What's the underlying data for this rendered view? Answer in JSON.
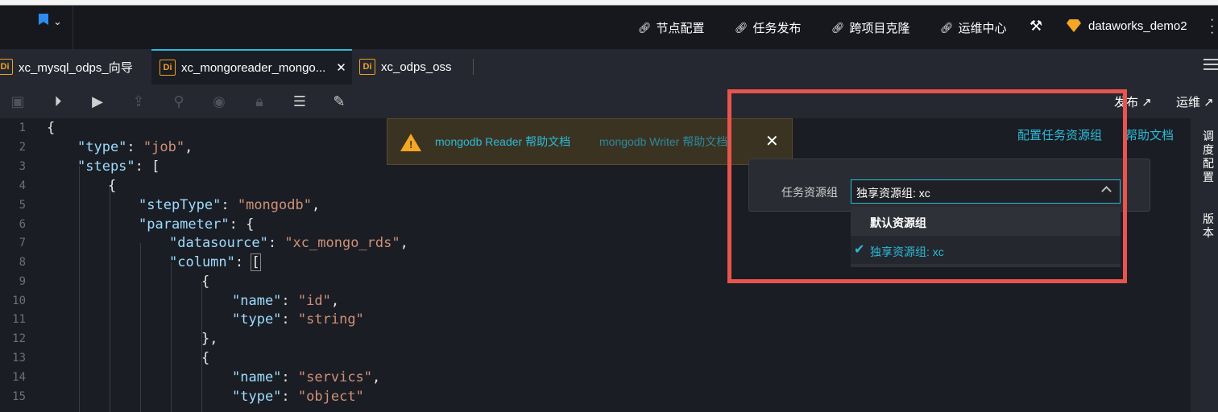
{
  "header": {
    "nav": [
      "节点配置",
      "任务发布",
      "跨项目克隆",
      "运维中心"
    ],
    "user": "dataworks_demo2"
  },
  "tabs": [
    {
      "label": "xc_mysql_odps_向导",
      "icon": "Di"
    },
    {
      "label": "xc_mongoreader_mongo...",
      "icon": "Di",
      "active": true
    },
    {
      "label": "xc_odps_oss",
      "icon": "Di"
    }
  ],
  "toolbar": {
    "publish_label": "发布 ↗",
    "ops_label": "运维 ↗"
  },
  "rail": {
    "schedule_label": "调度配置",
    "version_label": "版本"
  },
  "notice": {
    "reader_link": "mongodb Reader 帮助文档",
    "writer_link": "mongodb Writer 帮助文档"
  },
  "links": {
    "resource_group": "配置任务资源组",
    "help_doc": "帮助文档"
  },
  "resource_panel": {
    "label": "任务资源组",
    "selected": "独享资源组: xc",
    "options": [
      "默认资源组",
      "独享资源组: xc"
    ]
  },
  "code": {
    "line_numbers": [
      "1",
      "2",
      "3",
      "4",
      "5",
      "6",
      "7",
      "8",
      "9",
      "10",
      "11",
      "12",
      "13",
      "14",
      "15"
    ],
    "l1": "{",
    "k_type": "\"type\"",
    "v_job": "\"job\"",
    "k_steps": "\"steps\"",
    "k_stepType": "\"stepType\"",
    "v_mongodb": "\"mongodb\"",
    "k_parameter": "\"parameter\"",
    "k_datasource": "\"datasource\"",
    "v_ds": "\"xc_mongo_rds\"",
    "k_column": "\"column\"",
    "k_name": "\"name\"",
    "v_id": "\"id\"",
    "v_string": "\"string\"",
    "v_servics": "\"servics\"",
    "v_object": "\"object\""
  },
  "colors": {
    "accent": "#2bbbd8",
    "highlight_box": "#e8544e",
    "warning": "#f5a623"
  }
}
